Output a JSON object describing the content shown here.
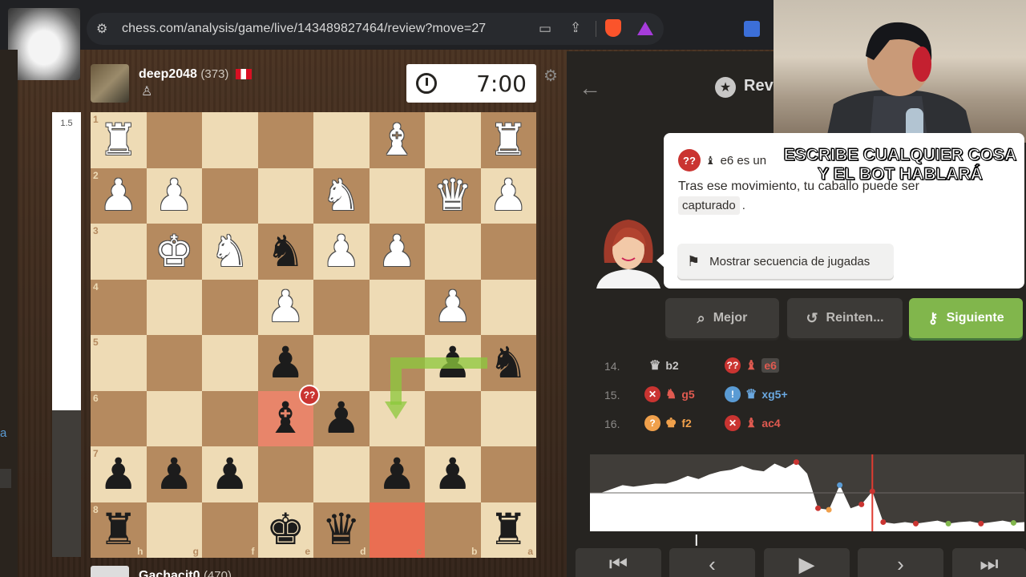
{
  "browser": {
    "url": "chess.com/analysis/game/live/143489827464/review?move=27",
    "tune_icon": "tune-icon",
    "cast_icon": "cast-icon",
    "share_icon": "share-icon",
    "brave_icon": "brave-shield-icon",
    "rewards_icon": "brave-rewards-icon",
    "extension_icon": "extension-icon"
  },
  "top_player": {
    "name": "deep2048",
    "rating": "(373)",
    "country": "peru-flag",
    "clock": "7:00"
  },
  "bottom_player": {
    "name": "Gachacit0",
    "rating": "(470)"
  },
  "eval_bar": {
    "label": "1.5",
    "white_fraction": 0.67
  },
  "board": {
    "orientation": "black",
    "ranks": [
      "1",
      "2",
      "3",
      "4",
      "5",
      "6",
      "7",
      "8"
    ],
    "files": [
      "h",
      "g",
      "f",
      "e",
      "d",
      "c",
      "b",
      "a"
    ],
    "rows": [
      [
        "wR",
        "",
        "",
        "",
        "",
        "wB",
        "",
        "wR"
      ],
      [
        "wP",
        "wP",
        "",
        "",
        "wN",
        "",
        "wQ",
        "wP"
      ],
      [
        "",
        "wK",
        "wN",
        "bN",
        "wP",
        "wP",
        "",
        ""
      ],
      [
        "",
        "",
        "",
        "wP",
        "",
        "",
        "wP",
        ""
      ],
      [
        "",
        "",
        "",
        "bP",
        "",
        "",
        "bP",
        "bN"
      ],
      [
        "",
        "",
        "",
        "bB",
        "bP",
        "",
        "",
        ""
      ],
      [
        "bP",
        "bP",
        "bP",
        "",
        "",
        "bP",
        "bP",
        ""
      ],
      [
        "bR",
        "",
        "",
        "bK",
        "bQ",
        "",
        "",
        "bR"
      ]
    ],
    "highlight_red": "e6",
    "highlight_orange": "c8",
    "blunder_badge": "??",
    "best_move_arrow": "b5-c6"
  },
  "review": {
    "back_icon": "back-arrow-icon",
    "star_icon": "star-icon",
    "title": "Rev"
  },
  "coach": {
    "badge": "??",
    "move_text": "e6 es un",
    "line2": "Tras ese movimiento, tu caballo puede ser",
    "chip": "capturado",
    "chip_suffix": ".",
    "sequence_button": "Mostrar secuencia de jugadas"
  },
  "stream_overlay": {
    "line1": "ESCRIBE CUALQUIER COSA",
    "line2": "Y EL BOT HABLARÁ"
  },
  "actions": {
    "best": "Mejor",
    "retry": "Reinten...",
    "next": "Siguiente"
  },
  "moves": [
    {
      "num": "14.",
      "white": {
        "piece": "♛",
        "sq": "b2",
        "badge": ""
      },
      "black": {
        "piece": "♝",
        "sq": "e6",
        "badge": "??"
      }
    },
    {
      "num": "15.",
      "white": {
        "piece": "♞",
        "sq": "g5",
        "badge": "✕"
      },
      "black": {
        "piece": "♛",
        "sq": "xg5+",
        "badge": "!"
      }
    },
    {
      "num": "16.",
      "white": {
        "piece": "♚",
        "sq": "f2",
        "badge": "?"
      },
      "black": {
        "piece": "♝",
        "sq": "ac4",
        "badge": "✕"
      }
    }
  ],
  "colors": {
    "accent": "#81b64c",
    "blunder": "#ca3431",
    "mistake": "#f0a04b",
    "brilliant": "#5a9bd4"
  },
  "graph": {
    "advantage": [
      0.5,
      0.5,
      0.55,
      0.6,
      0.58,
      0.6,
      0.62,
      0.62,
      0.66,
      0.72,
      0.68,
      0.74,
      0.78,
      0.8,
      0.85,
      0.8,
      0.78,
      0.88,
      0.82,
      0.9,
      0.75,
      0.3,
      0.28,
      0.6,
      0.3,
      0.35,
      0.52,
      0.12,
      0.1,
      0.12,
      0.1,
      0.12,
      0.14,
      0.1,
      0.12,
      0.13,
      0.1,
      0.12,
      0.14,
      0.11,
      0.12
    ],
    "current_index": 26
  },
  "nav": {
    "first": "first-icon",
    "prev": "prev-icon",
    "play": "play-icon",
    "next": "next-icon",
    "last": "last-icon"
  }
}
